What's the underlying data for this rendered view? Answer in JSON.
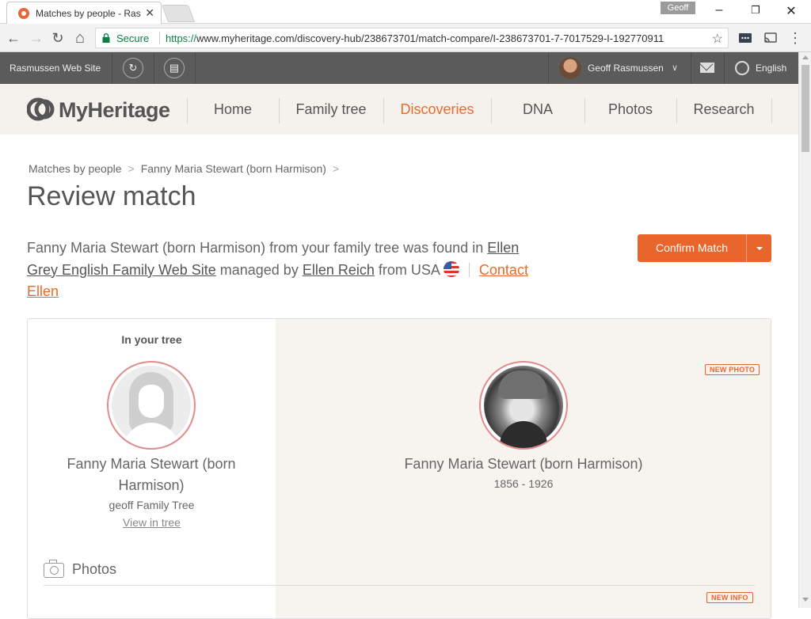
{
  "browser": {
    "tab_title": "Matches by people - Ras",
    "tab_close": "✕",
    "profile": "Geoff",
    "secure_label": "Secure",
    "url_scheme": "https://",
    "url_rest": "www.myheritage.com/discovery-hub/238673701/match-compare/I-238673701-7-7017529-I-192770911",
    "win_minimize": "–",
    "win_restore": "❐",
    "win_close": "✕",
    "back": "←",
    "forward": "→",
    "reload": "↻",
    "home": "⌂",
    "star": "☆",
    "menu": "⋮"
  },
  "topbar": {
    "site_name": "Rasmussen Web Site",
    "sync_icon": "↻",
    "tree_icon": "▤",
    "user_name": "Geoff Rasmussen",
    "user_chevron": "∨",
    "language": "English"
  },
  "nav": {
    "logo_text": "MyHeritage",
    "items": [
      {
        "label": "Home"
      },
      {
        "label": "Family tree"
      },
      {
        "label": "Discoveries"
      },
      {
        "label": "DNA"
      },
      {
        "label": "Photos"
      },
      {
        "label": "Research"
      }
    ],
    "active": "Discoveries"
  },
  "breadcrumb": {
    "items": [
      "Matches by people",
      "Fanny Maria Stewart (born Harmison)"
    ],
    "separator": ">"
  },
  "page": {
    "title": "Review match",
    "desc_part1": "Fanny Maria Stewart (born Harmison) from your family tree was found in ",
    "site_link": "Ellen Grey English Family Web Site",
    "desc_part2": " managed by ",
    "manager_link": "Ellen Reich",
    "desc_part3": " from USA ",
    "contact_link": "Contact Ellen",
    "confirm_button": "Confirm Match"
  },
  "compare": {
    "left_header": "In your tree",
    "left_name": "Fanny Maria Stewart (born Harmison)",
    "left_tree": "geoff Family Tree",
    "left_view_link": "View in tree",
    "right_name": "Fanny Maria Stewart (born Harmison)",
    "right_years": "1856 - 1926",
    "tag_new_photo": "NEW PHOTO",
    "tag_new_info": "NEW INFO",
    "photos_section": "Photos"
  },
  "colors": {
    "accent": "#e8662c",
    "topbar": "#5b5b5b",
    "nav_bg": "#f5f2ee",
    "right_panel": "#f7f3ee",
    "avatar_ring": "#e08c8c"
  }
}
